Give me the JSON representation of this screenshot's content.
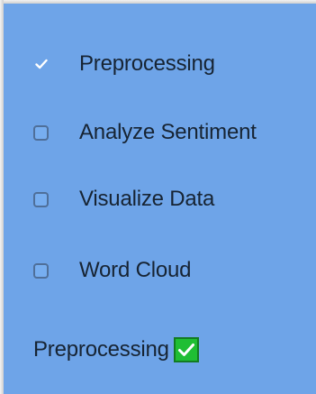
{
  "checklist": {
    "items": [
      {
        "label": "Preprocessing",
        "checked": true
      },
      {
        "label": "Analyze Sentiment",
        "checked": false
      },
      {
        "label": "Visualize Data",
        "checked": false
      },
      {
        "label": "Word Cloud",
        "checked": false
      }
    ]
  },
  "status": {
    "text": "Preprocessing",
    "icon": "green-checkmark-icon",
    "icon_color": "#1fbe34"
  },
  "colors": {
    "panel_background": "#6ea4e8",
    "text": "#172433",
    "checkbox_border": "#4f6f99"
  }
}
